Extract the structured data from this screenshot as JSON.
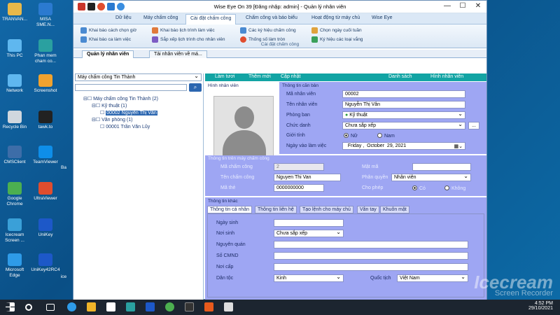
{
  "desktop_icons": [
    {
      "label": "TRANVAN...",
      "icon": "user-folder-icon",
      "color": "#e8b84a"
    },
    {
      "label": "MISA SME.N...",
      "icon": "misa-icon",
      "color": "#2b7ad0"
    },
    {
      "label": "This PC",
      "icon": "computer-icon",
      "color": "#5fb7ef"
    },
    {
      "label": "Phan mem cham co...",
      "icon": "fingerprint-app-icon",
      "color": "#2aa0a0"
    },
    {
      "label": "Network",
      "icon": "network-icon",
      "color": "#5fb7ef"
    },
    {
      "label": "Screenshot",
      "icon": "screenshot-icon",
      "color": "#f0a22e"
    },
    {
      "label": "Recycle Bin",
      "icon": "recycle-bin-icon",
      "color": "#d0d7de"
    },
    {
      "label": "tawk.to",
      "icon": "chat-icon",
      "color": "#222"
    },
    {
      "label": "CMSClient",
      "icon": "cms-icon",
      "color": "#3d6da8"
    },
    {
      "label": "TeamViewer",
      "icon": "teamviewer-icon",
      "color": "#0e8ee9"
    },
    {
      "label": "Google Chrome",
      "icon": "chrome-icon",
      "color": "#4caf50"
    },
    {
      "label": "UltraViewer",
      "icon": "ultraviewer-icon",
      "color": "#e04d2f"
    },
    {
      "label": "Icecream Screen ...",
      "icon": "icecream-icon",
      "color": "#3aa0d8"
    },
    {
      "label": "UniKey",
      "icon": "unikey-icon",
      "color": "#1d58c8"
    },
    {
      "label": "Microsoft Edge",
      "icon": "edge-icon",
      "color": "#2e9be8"
    },
    {
      "label": "UniKey42RC4",
      "icon": "unikey-icon",
      "color": "#1d58c8"
    }
  ],
  "desktop_icons_extra": [
    {
      "label": "Ba"
    },
    {
      "label": "ice"
    }
  ],
  "window": {
    "title": "Wise Eye On 39 [Đăng nhập: admin] - Quản lý nhân viên",
    "controls": [
      "—",
      "☐",
      "✕"
    ]
  },
  "ribbon": {
    "tabs": [
      "Dữ liệu",
      "Máy chấm công",
      "Cài đặt chấm công",
      "Chấm công và báo biểu",
      "Hoạt động từ máy chủ",
      "Wise Eye"
    ],
    "active_tab": "Cài đặt chấm công",
    "items": [
      {
        "label": "Khai báo cách chọn giờ",
        "icon": "clock-settings-icon",
        "color": "#4a8ad1"
      },
      {
        "label": "Khai báo ca làm việc",
        "icon": "shift-icon",
        "color": "#4a8ad1"
      },
      {
        "label": "Khai báo lịch trình làm việc",
        "icon": "calendar-icon",
        "color": "#e07a3c"
      },
      {
        "label": "Sắp xếp lịch trình cho nhân viên",
        "icon": "schedule-icon",
        "color": "#7c5cc4"
      },
      {
        "label": "Các ký hiệu chấm công",
        "icon": "symbols-icon",
        "color": "#4a8ad1"
      },
      {
        "label": "Thống số làm tròn",
        "icon": "rounding-icon",
        "color": "#e04d2f"
      },
      {
        "label": "Chọn ngày cuối tuần",
        "icon": "weekend-icon",
        "color": "#e0a33c"
      },
      {
        "label": "Ký hiệu các loại vắng",
        "icon": "absence-icon",
        "color": "#3aa05a"
      }
    ],
    "group_label": "Cài đặt chấm công"
  },
  "doc_tabs": [
    "Quản lý nhân viên",
    "Tải nhân viên về má..."
  ],
  "left": {
    "device_select": "Máy chấm công Tin Thành",
    "search_placeholder": "",
    "tree": [
      {
        "label": "Máy chấm công Tin Thành (2)"
      },
      {
        "label": "Kỹ thuật (1)"
      },
      {
        "label": "00002 Nguyễn Thị Vân",
        "selected": true
      },
      {
        "label": "Văn phòng (1)"
      },
      {
        "label": "00001 Trần Văn Lũy"
      }
    ]
  },
  "toolbar": {
    "refresh": "Làm tươi",
    "add": "Thêm mới",
    "update": "Cập nhật",
    "list": "Danh sách",
    "photo": "Hình nhân viên"
  },
  "basic": {
    "photo_section": "Hình nhân viên",
    "section": "Thông tin căn bản",
    "emp_code_label": "Mã nhân viên",
    "emp_code": "00002",
    "name_label": "Tên nhân viên",
    "name": "Nguyễn Thị Vân",
    "dept_label": "Phòng ban",
    "dept": "Kỹ thuật",
    "title_label": "Chức danh",
    "title": "Chưa sắp xếp",
    "gender_label": "Giới tính",
    "gender_female": "Nữ",
    "gender_male": "Nam",
    "start_label": "Ngày vào làm việc",
    "start_day": "Friday",
    "start_month": "October",
    "start_date": "29, 2021"
  },
  "device": {
    "section": "Thông tin trên máy chấm công",
    "code_label": "Mã chấm công",
    "code": "2",
    "password_label": "Mật mã",
    "password": "",
    "name_label": "Tên chấm công",
    "name": "Nguyen Thi Van",
    "role_label": "Phân quyền",
    "role": "Nhân viên",
    "card_label": "Mã thẻ",
    "card": "0000000000",
    "allow_label": "Cho phép",
    "allow_yes": "Có",
    "allow_no": "Không"
  },
  "other": {
    "section": "Thông tin khác",
    "tabs": [
      "Thông tin cá nhân",
      "Thông tin liên hệ",
      "Tạo lệnh cho máy chủ",
      "Vân tay",
      "Khuôn mặt"
    ],
    "birth_label": "Ngày sinh",
    "birth": "",
    "birthplace_label": "Nơi sinh",
    "birthplace": "Chưa sắp xếp",
    "origin_label": "Nguyên quán",
    "origin": "",
    "id_label": "Số CMND",
    "id": "",
    "issued_label": "Nơi cấp",
    "issued": "",
    "ethnic_label": "Dân tộc",
    "ethnic": "Kinh",
    "nation_label": "Quốc tịch",
    "nation": "Việt Nam"
  },
  "watermark": {
    "line1": "Icecream",
    "line2": "Screen Recorder"
  },
  "taskbar": {
    "time": "4:52 PM",
    "date": "29/10/2021"
  }
}
